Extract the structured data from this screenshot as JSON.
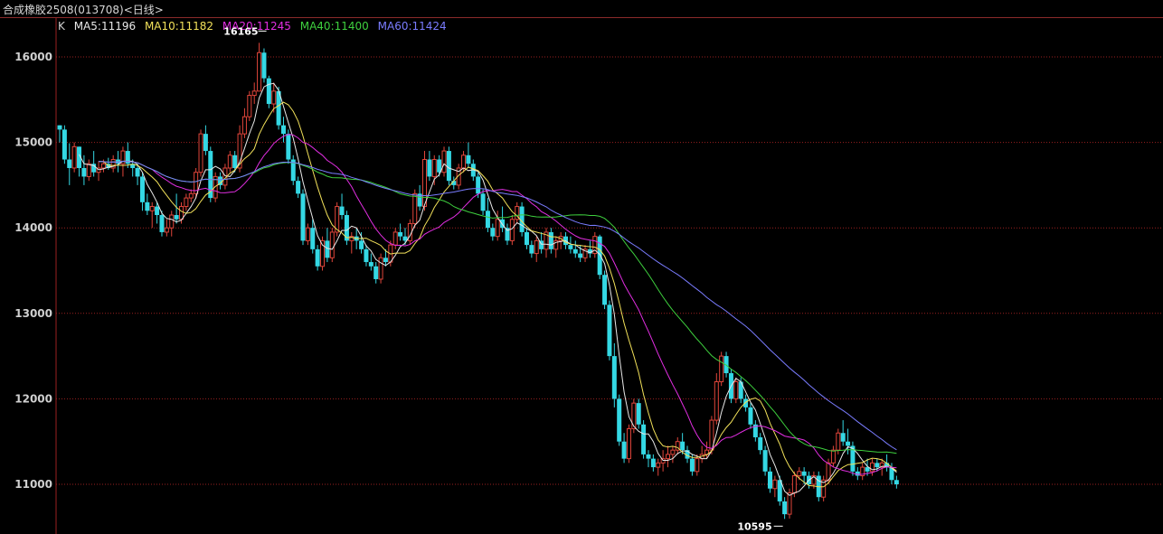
{
  "title": "合成橡胶2508(013708)<日线>",
  "legend": {
    "k": "K",
    "items": [
      {
        "text": "MA5:11196",
        "color": "#e8e8e8"
      },
      {
        "text": "MA10:11182",
        "color": "#f2e15a"
      },
      {
        "text": "MA20:11245",
        "color": "#e22ee2"
      },
      {
        "text": "MA40:11400",
        "color": "#3ed03e"
      },
      {
        "text": "MA60:11424",
        "color": "#7a7cff"
      }
    ]
  },
  "colors": {
    "up": "#e0453a",
    "down": "#34d8e4",
    "grid": "#9a2020",
    "axis": "#9a2020",
    "ma5": "#e8e8e8",
    "ma10": "#f2e15a",
    "ma20": "#e22ee2",
    "ma40": "#3ed03e",
    "ma60": "#7a7cff"
  },
  "chart_data": {
    "type": "candlestick",
    "yticks": [
      16000,
      15000,
      14000,
      13000,
      12000,
      11000
    ],
    "ylim": [
      10480,
      16480
    ],
    "high_label": "16165",
    "low_label": "10595",
    "ohlc": [
      [
        15200,
        15200,
        15000,
        15150
      ],
      [
        15150,
        15200,
        14750,
        14800
      ],
      [
        14800,
        14990,
        14500,
        14700
      ],
      [
        14700,
        15000,
        14650,
        14950
      ],
      [
        14950,
        14950,
        14600,
        14700
      ],
      [
        14700,
        14850,
        14500,
        14600
      ],
      [
        14600,
        14800,
        14550,
        14750
      ],
      [
        14750,
        14900,
        14600,
        14650
      ],
      [
        14650,
        14780,
        14550,
        14700
      ],
      [
        14700,
        14800,
        14650,
        14750
      ],
      [
        14750,
        14820,
        14680,
        14700
      ],
      [
        14700,
        14850,
        14650,
        14800
      ],
      [
        14800,
        14900,
        14650,
        14750
      ],
      [
        14750,
        14950,
        14600,
        14900
      ],
      [
        14900,
        15000,
        14700,
        14750
      ],
      [
        14750,
        14800,
        14600,
        14700
      ],
      [
        14700,
        14750,
        14500,
        14600
      ],
      [
        14600,
        14650,
        14200,
        14300
      ],
      [
        14300,
        14400,
        14150,
        14200
      ],
      [
        14200,
        14300,
        14000,
        14250
      ],
      [
        14250,
        14300,
        14050,
        14150
      ],
      [
        14150,
        14200,
        13900,
        13950
      ],
      [
        13950,
        14100,
        13900,
        14000
      ],
      [
        14000,
        14200,
        13900,
        14150
      ],
      [
        14150,
        14400,
        14050,
        14100
      ],
      [
        14100,
        14300,
        14050,
        14250
      ],
      [
        14250,
        14400,
        14200,
        14350
      ],
      [
        14350,
        14450,
        14300,
        14400
      ],
      [
        14400,
        14700,
        14350,
        14650
      ],
      [
        14650,
        15150,
        14600,
        15100
      ],
      [
        15100,
        15200,
        14850,
        14900
      ],
      [
        14900,
        14950,
        14300,
        14350
      ],
      [
        14350,
        14650,
        14300,
        14600
      ],
      [
        14600,
        14650,
        14450,
        14500
      ],
      [
        14500,
        14750,
        14450,
        14700
      ],
      [
        14700,
        14900,
        14650,
        14850
      ],
      [
        14850,
        14900,
        14650,
        14700
      ],
      [
        14700,
        15200,
        14650,
        15100
      ],
      [
        15100,
        15400,
        15050,
        15300
      ],
      [
        15300,
        15600,
        15250,
        15550
      ],
      [
        15550,
        15700,
        15450,
        15600
      ],
      [
        15600,
        16165,
        15600,
        16050
      ],
      [
        16050,
        16100,
        15700,
        15750
      ],
      [
        15750,
        15780,
        15400,
        15450
      ],
      [
        15450,
        15700,
        15350,
        15600
      ],
      [
        15600,
        15650,
        15150,
        15200
      ],
      [
        15200,
        15300,
        15000,
        15100
      ],
      [
        15100,
        15150,
        14750,
        14800
      ],
      [
        14800,
        14850,
        14500,
        14550
      ],
      [
        14550,
        14600,
        14350,
        14400
      ],
      [
        14400,
        14450,
        13800,
        13850
      ],
      [
        13850,
        14050,
        13800,
        14000
      ],
      [
        14000,
        14100,
        13700,
        13750
      ],
      [
        13750,
        13800,
        13500,
        13550
      ],
      [
        13550,
        13900,
        13500,
        13850
      ],
      [
        13850,
        14000,
        13600,
        13650
      ],
      [
        13650,
        14000,
        13600,
        13950
      ],
      [
        13950,
        14300,
        13900,
        14250
      ],
      [
        14250,
        14400,
        14100,
        14150
      ],
      [
        14150,
        14200,
        13800,
        13850
      ],
      [
        13850,
        13950,
        13700,
        13900
      ],
      [
        13900,
        14000,
        13750,
        13850
      ],
      [
        13850,
        13950,
        13700,
        13750
      ],
      [
        13750,
        13800,
        13550,
        13600
      ],
      [
        13600,
        13700,
        13500,
        13550
      ],
      [
        13550,
        13600,
        13350,
        13400
      ],
      [
        13400,
        13700,
        13350,
        13650
      ],
      [
        13650,
        13750,
        13550,
        13600
      ],
      [
        13600,
        13850,
        13550,
        13800
      ],
      [
        13800,
        14000,
        13750,
        13950
      ],
      [
        13950,
        14050,
        13850,
        13900
      ],
      [
        13900,
        14000,
        13800,
        13850
      ],
      [
        13850,
        14100,
        13800,
        14050
      ],
      [
        14050,
        14450,
        14000,
        14400
      ],
      [
        14400,
        14500,
        14200,
        14250
      ],
      [
        14250,
        14900,
        14200,
        14800
      ],
      [
        14800,
        14900,
        14550,
        14600
      ],
      [
        14600,
        14850,
        14500,
        14800
      ],
      [
        14800,
        14850,
        14600,
        14650
      ],
      [
        14650,
        14950,
        14600,
        14900
      ],
      [
        14900,
        14950,
        14500,
        14550
      ],
      [
        14550,
        14600,
        14450,
        14500
      ],
      [
        14500,
        14750,
        14450,
        14700
      ],
      [
        14700,
        14900,
        14650,
        14850
      ],
      [
        14850,
        15000,
        14700,
        14750
      ],
      [
        14750,
        14800,
        14550,
        14600
      ],
      [
        14600,
        14650,
        14350,
        14400
      ],
      [
        14400,
        14450,
        14150,
        14200
      ],
      [
        14200,
        14350,
        13950,
        14000
      ],
      [
        14000,
        14050,
        13850,
        13900
      ],
      [
        13900,
        14200,
        13850,
        14100
      ],
      [
        14100,
        14250,
        13950,
        14000
      ],
      [
        14000,
        14050,
        13800,
        13850
      ],
      [
        13850,
        14150,
        13800,
        14100
      ],
      [
        14100,
        14300,
        14050,
        14250
      ],
      [
        14250,
        14300,
        13900,
        13950
      ],
      [
        13950,
        14000,
        13750,
        13800
      ],
      [
        13800,
        13850,
        13650,
        13700
      ],
      [
        13700,
        13900,
        13600,
        13850
      ],
      [
        13850,
        13950,
        13700,
        13750
      ],
      [
        13750,
        14000,
        13650,
        13950
      ],
      [
        13950,
        14000,
        13700,
        13750
      ],
      [
        13750,
        13900,
        13650,
        13850
      ],
      [
        13850,
        13950,
        13750,
        13900
      ],
      [
        13900,
        13950,
        13750,
        13800
      ],
      [
        13800,
        13900,
        13700,
        13750
      ],
      [
        13750,
        13850,
        13650,
        13700
      ],
      [
        13700,
        13800,
        13600,
        13650
      ],
      [
        13650,
        13800,
        13600,
        13750
      ],
      [
        13750,
        13850,
        13650,
        13700
      ],
      [
        13700,
        13950,
        13650,
        13900
      ],
      [
        13900,
        13920,
        13400,
        13450
      ],
      [
        13450,
        13500,
        13050,
        13100
      ],
      [
        13100,
        13150,
        12450,
        12500
      ],
      [
        12500,
        12650,
        11900,
        12000
      ],
      [
        12000,
        12050,
        11450,
        11500
      ],
      [
        11500,
        11600,
        11250,
        11300
      ],
      [
        11300,
        11700,
        11250,
        11650
      ],
      [
        11650,
        12000,
        11600,
        11950
      ],
      [
        11950,
        12000,
        11650,
        11700
      ],
      [
        11700,
        11750,
        11300,
        11350
      ],
      [
        11350,
        11400,
        11200,
        11300
      ],
      [
        11300,
        11350,
        11150,
        11200
      ],
      [
        11200,
        11300,
        11100,
        11250
      ],
      [
        11250,
        11400,
        11150,
        11300
      ],
      [
        11300,
        11450,
        11200,
        11350
      ],
      [
        11350,
        11450,
        11250,
        11400
      ],
      [
        11400,
        11550,
        11350,
        11500
      ],
      [
        11500,
        11600,
        11350,
        11400
      ],
      [
        11400,
        11450,
        11250,
        11300
      ],
      [
        11300,
        11350,
        11100,
        11150
      ],
      [
        11150,
        11350,
        11100,
        11300
      ],
      [
        11300,
        11450,
        11250,
        11350
      ],
      [
        11350,
        11500,
        11300,
        11400
      ],
      [
        11400,
        11800,
        11350,
        11750
      ],
      [
        11750,
        12300,
        11700,
        12200
      ],
      [
        12200,
        12550,
        12150,
        12500
      ],
      [
        12500,
        12550,
        12250,
        12300
      ],
      [
        12300,
        12350,
        11950,
        12000
      ],
      [
        12000,
        12250,
        11950,
        12200
      ],
      [
        12200,
        12250,
        11950,
        12000
      ],
      [
        12000,
        12050,
        11850,
        11900
      ],
      [
        11900,
        11950,
        11650,
        11700
      ],
      [
        11700,
        11750,
        11500,
        11550
      ],
      [
        11550,
        11600,
        11350,
        11400
      ],
      [
        11400,
        11450,
        11100,
        11150
      ],
      [
        11150,
        11200,
        10900,
        10950
      ],
      [
        10950,
        11100,
        10850,
        11050
      ],
      [
        11050,
        11100,
        10750,
        10800
      ],
      [
        10800,
        10850,
        10595,
        10650
      ],
      [
        10650,
        10950,
        10600,
        10900
      ],
      [
        10900,
        11150,
        10850,
        11100
      ],
      [
        11100,
        11200,
        11050,
        11150
      ],
      [
        11150,
        11200,
        11000,
        11100
      ],
      [
        11100,
        11150,
        10950,
        11000
      ],
      [
        11000,
        11150,
        10950,
        11100
      ],
      [
        11100,
        11150,
        10800,
        10850
      ],
      [
        10850,
        11100,
        10800,
        11050
      ],
      [
        11050,
        11300,
        11000,
        11250
      ],
      [
        11250,
        11450,
        11200,
        11400
      ],
      [
        11400,
        11650,
        11350,
        11600
      ],
      [
        11600,
        11750,
        11450,
        11500
      ],
      [
        11500,
        11650,
        11350,
        11450
      ],
      [
        11450,
        11500,
        11100,
        11150
      ],
      [
        11150,
        11200,
        11050,
        11100
      ],
      [
        11100,
        11250,
        11050,
        11200
      ],
      [
        11200,
        11300,
        11100,
        11150
      ],
      [
        11150,
        11300,
        11100,
        11250
      ],
      [
        11250,
        11300,
        11150,
        11200
      ],
      [
        11200,
        11300,
        11100,
        11250
      ],
      [
        11250,
        11350,
        11150,
        11200
      ],
      [
        11200,
        11250,
        11000,
        11050
      ],
      [
        11050,
        11100,
        10950,
        11000
      ]
    ]
  }
}
